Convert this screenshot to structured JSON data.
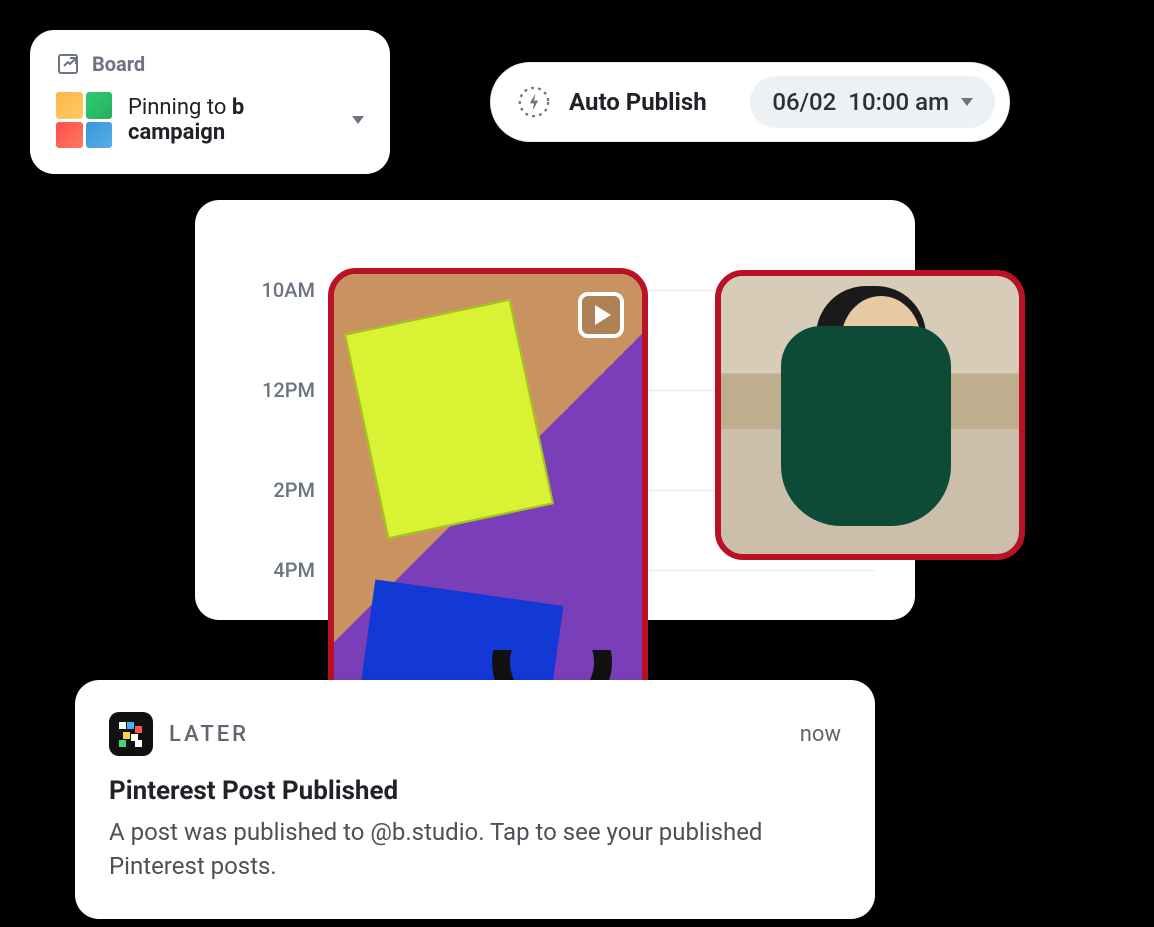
{
  "board": {
    "header_label": "Board",
    "pinning_prefix": "Pinning to ",
    "campaign_name": "b campaign"
  },
  "publish": {
    "label": "Auto Publish",
    "date": "06/02",
    "time": "10:00 am"
  },
  "calendar": {
    "times": [
      "10AM",
      "12PM",
      "2PM",
      "4PM"
    ]
  },
  "notification": {
    "app_name": "LATER",
    "time_label": "now",
    "title": "Pinterest Post Published",
    "body": "A post was published to @b.studio. Tap to see your published Pinterest posts."
  }
}
